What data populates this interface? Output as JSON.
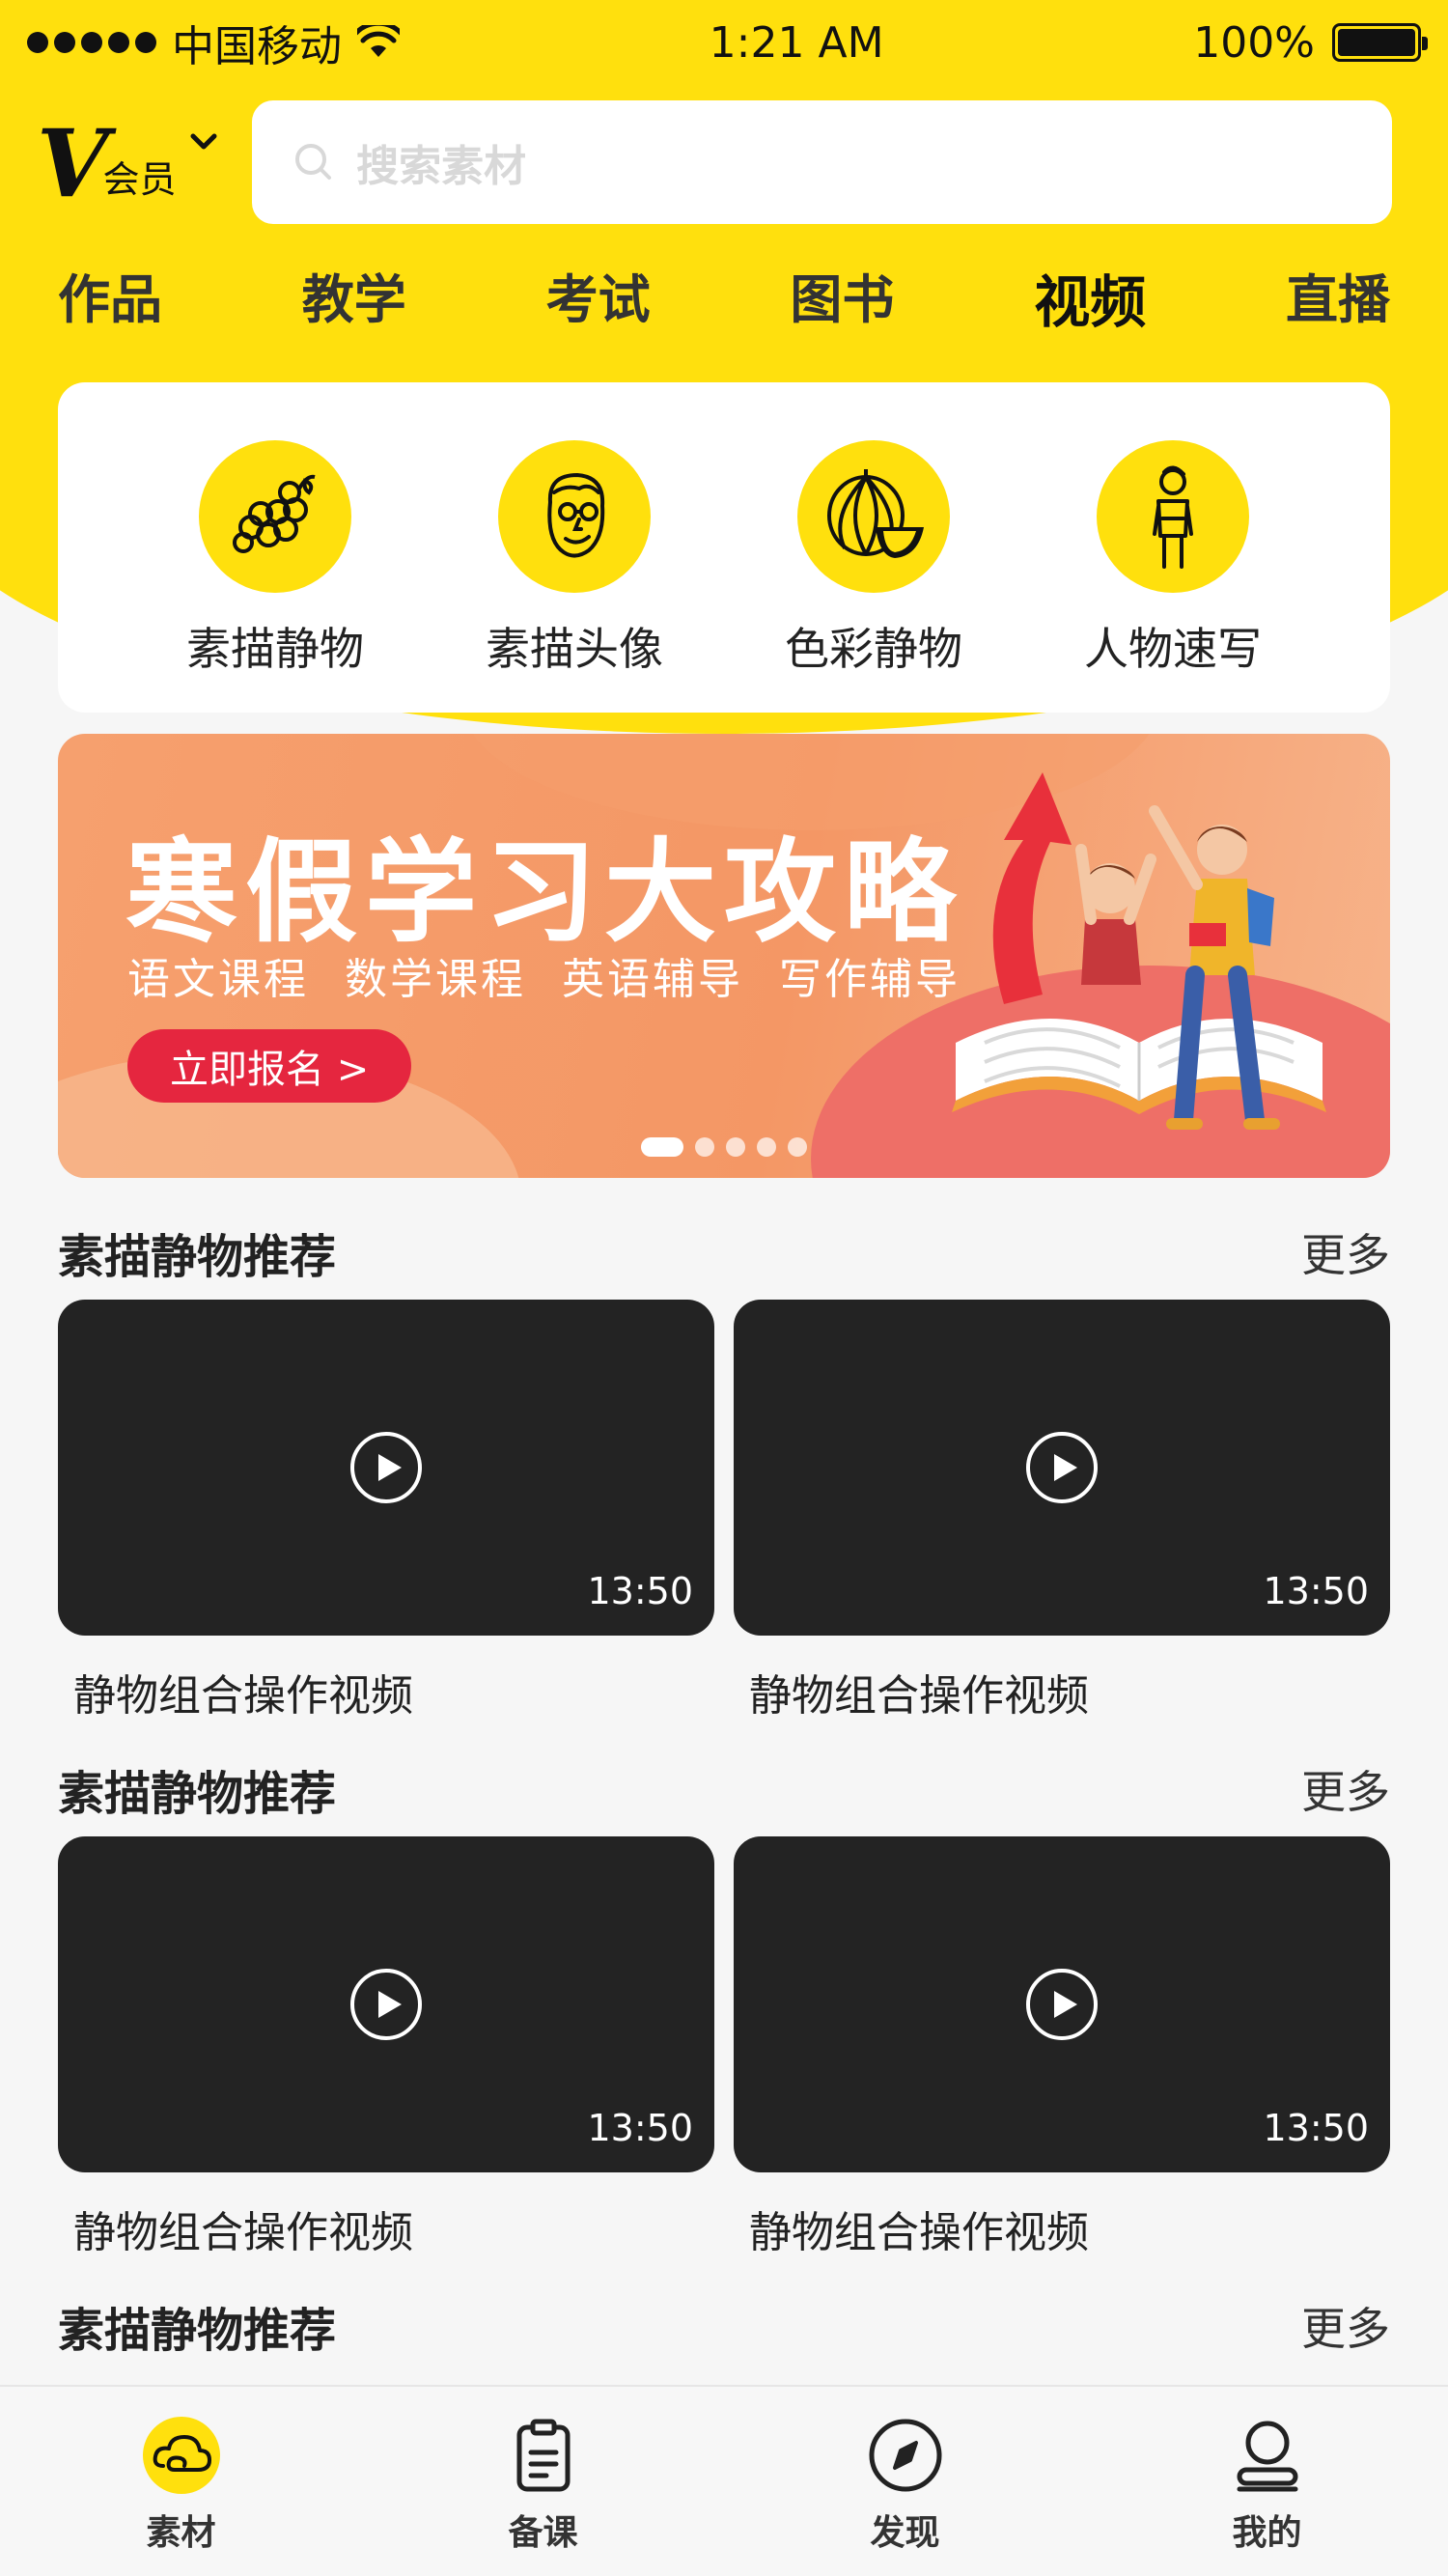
{
  "status_bar": {
    "carrier": "中国移动",
    "time": "1:21 AM",
    "battery": "100%"
  },
  "header": {
    "vip_letter": "V",
    "vip_text": "会员",
    "search_placeholder": "搜索素材"
  },
  "tabs": [
    {
      "label": "作品"
    },
    {
      "label": "教学"
    },
    {
      "label": "考试"
    },
    {
      "label": "图书"
    },
    {
      "label": "视频"
    },
    {
      "label": "直播"
    }
  ],
  "categories": [
    {
      "label": "素描静物",
      "icon": "grapes-icon"
    },
    {
      "label": "素描头像",
      "icon": "face-icon"
    },
    {
      "label": "色彩静物",
      "icon": "watermelon-icon"
    },
    {
      "label": "人物速写",
      "icon": "figure-icon"
    }
  ],
  "banner": {
    "title": "寒假学习大攻略",
    "subtitle": "语文课程 数学课程 英语辅导 写作辅导",
    "cta": "立即报名 >",
    "pages": 5,
    "active_page": 1
  },
  "sections": [
    {
      "title": "素描静物推荐",
      "more": "更多",
      "videos": [
        {
          "title": "静物组合操作视频",
          "duration": "13:50"
        },
        {
          "title": "静物组合操作视频",
          "duration": "13:50"
        }
      ]
    },
    {
      "title": "素描静物推荐",
      "more": "更多",
      "videos": [
        {
          "title": "静物组合操作视频",
          "duration": "13:50"
        },
        {
          "title": "静物组合操作视频",
          "duration": "13:50"
        }
      ]
    },
    {
      "title": "素描静物推荐",
      "more": "更多",
      "videos": []
    }
  ],
  "bottom_nav": [
    {
      "label": "素材",
      "icon": "cloud-icon",
      "active": true
    },
    {
      "label": "备课",
      "icon": "clipboard-icon",
      "active": false
    },
    {
      "label": "发现",
      "icon": "compass-icon",
      "active": false
    },
    {
      "label": "我的",
      "icon": "user-icon",
      "active": false
    }
  ],
  "colors": {
    "brand_yellow": "#ffe00d",
    "cta_red": "#e5263f",
    "video_bg": "#232323"
  }
}
